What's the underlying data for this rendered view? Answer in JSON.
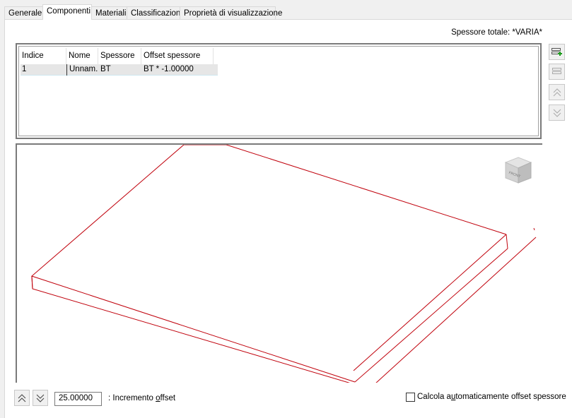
{
  "tabs": [
    {
      "label": "Generale"
    },
    {
      "label": "Componenti"
    },
    {
      "label": "Materiali"
    },
    {
      "label": "Classificazioni"
    },
    {
      "label": "Proprietà di visualizzazione"
    }
  ],
  "active_tab": "Componenti",
  "total_thickness": "Spessore totale: *VARIA*",
  "grid": {
    "columns": [
      "Indice",
      "Nome",
      "Spessore",
      "Offset spessore"
    ],
    "rows": [
      {
        "indice": "1",
        "nome": "Unnam...",
        "spessore": "BT",
        "offset": "BT * -1.00000"
      }
    ]
  },
  "side_buttons": [
    "add-component-icon",
    "remove-component-icon",
    "move-up-icon",
    "move-down-icon"
  ],
  "view_cube_label": "FRONT",
  "bottom": {
    "offset_value": "25.00000",
    "offset_label_prefix": ": Incremento ",
    "offset_label_key": "o",
    "offset_label_suffix": "ffset",
    "auto_checkbox_checked": false,
    "auto_label_prefix": "Calcola a",
    "auto_label_key": "u",
    "auto_label_suffix": "tomaticamente offset spessore"
  },
  "colors": {
    "model_line": "#c0000b",
    "selection_row": "#e6e6e6"
  }
}
